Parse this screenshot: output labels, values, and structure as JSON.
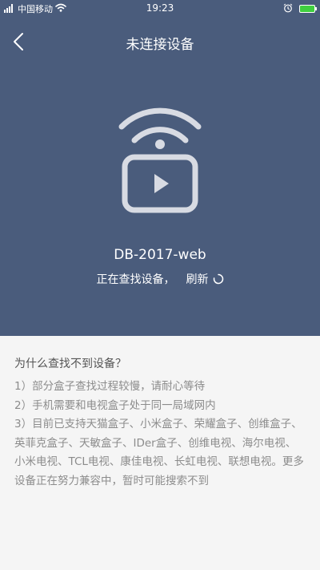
{
  "status_bar": {
    "carrier": "中国移动",
    "time": "19:23",
    "icons": [
      "signal-icon",
      "wifi-icon",
      "alarm-icon",
      "battery-icon"
    ]
  },
  "header": {
    "title": "未连接设备",
    "back_icon": "chevron-left-icon"
  },
  "device": {
    "icon": "cast-tv-icon",
    "name": "DB-2017-web",
    "status": "正在查找设备，",
    "refresh_label": "刷新",
    "refresh_icon": "spinner-icon"
  },
  "help": {
    "title": "为什么查找不到设备？",
    "items": [
      "1）部分盒子查找过程较慢，请耐心等待",
      "2）手机需要和电视盒子处于同一局域网内",
      "3）目前已支持天猫盒子、小米盒子、荣耀盒子、创维盒子、英菲克盒子、天敏盒子、IDer盒子、创维电视、海尔电视、小米电视、TCL电视、康佳电视、长虹电视、联想电视。更多设备正在努力兼容中，暂时可能搜索不到"
    ]
  },
  "colors": {
    "header_bg": "#4a5c7c",
    "page_bg": "#f5f5f5",
    "help_title": "#555555",
    "help_text": "#8c8c8c",
    "battery": "#3fcf3f"
  }
}
